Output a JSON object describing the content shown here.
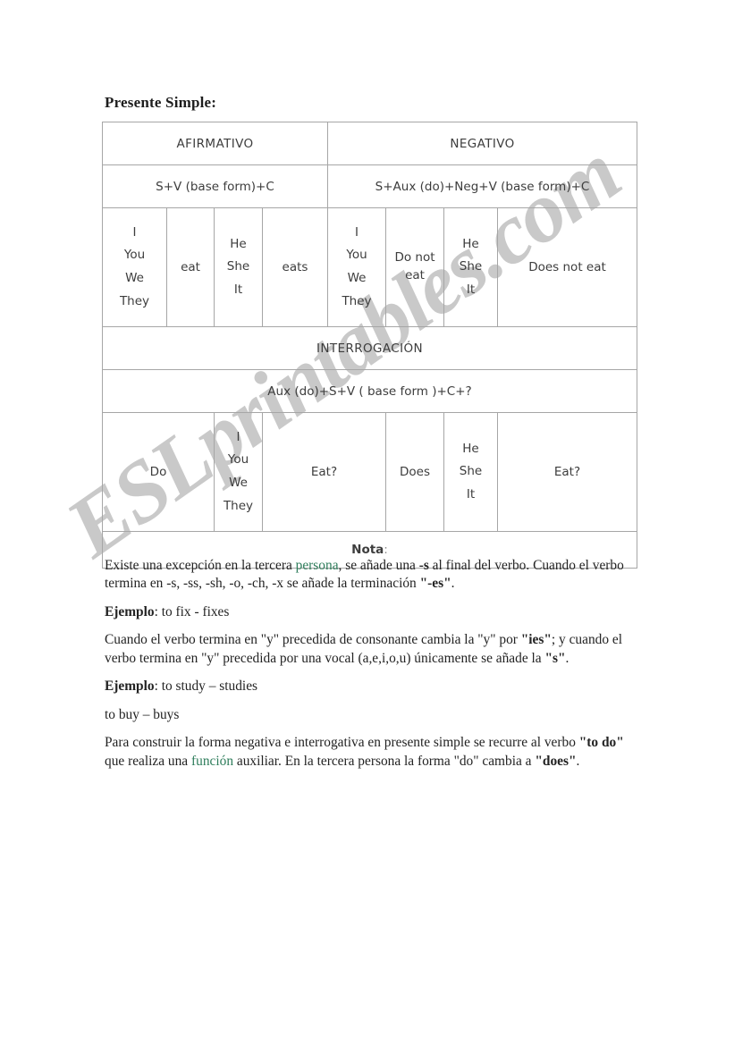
{
  "document": {
    "title": "Presente Simple:"
  },
  "table": {
    "headers": {
      "affirmative": "AFIRMATIVO",
      "negative": "NEGATIVO",
      "interrogative": "INTERROGACIÓN"
    },
    "formulas": {
      "affirmative": "S+V (base form)+C",
      "negative": "S+Aux (do)+Neg+V (base form)+C",
      "interrogative": "Aux (do)+S+V ( base form )+C+?"
    },
    "affirmative_row": {
      "plural_pronouns": [
        "I",
        "You",
        "We",
        "They"
      ],
      "plural_verb": "eat",
      "third_person_pronouns": [
        "He",
        "She",
        "It"
      ],
      "third_person_verb": "eats"
    },
    "negative_row": {
      "plural_pronouns": [
        "I",
        "You",
        "We",
        "They"
      ],
      "plural_verb": "Do not eat",
      "third_person_pronouns": [
        "He",
        "She",
        "It"
      ],
      "third_person_verb": "Does not eat"
    },
    "interrogative_row": {
      "plural_aux": "Do",
      "plural_pronouns": [
        "I",
        "You",
        "We",
        "They"
      ],
      "plural_verb": "Eat?",
      "third_person_aux": "Does",
      "third_person_pronouns": [
        "He",
        "She",
        "It"
      ],
      "third_person_verb": "Eat?"
    },
    "note_label": "Nota",
    "note_colon": ":"
  },
  "body": {
    "p1_a": "Existe una excepción en la tercera ",
    "p1_link": "persona",
    "p1_b": ", se añade una ",
    "p1_bold1": "-s",
    "p1_c": " al final del verbo. Cuando el verbo termina en -s, -ss, -sh, -o, -ch, -x se añade la terminación ",
    "p1_bold2": "\"-es\"",
    "p1_d": ".",
    "p2_label": "Ejemplo",
    "p2_text": ": to fix - fixes",
    "p3_a": "Cuando el verbo termina en \"y\" precedida de consonante cambia la \"y\" por ",
    "p3_bold1": "\"ies\"",
    "p3_b": "; y cuando el verbo termina en \"y\" precedida por una vocal (a,e,i,o,u) únicamente se añade la ",
    "p3_bold2": "\"s\"",
    "p3_c": ".",
    "p4_label": "Ejemplo",
    "p4_text": ": to study – studies",
    "p5_text": "to buy – buys",
    "p6_a": "Para construir la forma negativa e interrogativa en presente simple se recurre al verbo ",
    "p6_bold1": "\"to do\"",
    "p6_b": " que realiza una ",
    "p6_link": "función",
    "p6_c": " auxiliar. En la tercera persona la forma \"do\" cambia a ",
    "p6_bold2": "\"does\"",
    "p6_d": "."
  },
  "watermark": {
    "text": "ESLprintables.com",
    "color": "#c9c9c9"
  }
}
